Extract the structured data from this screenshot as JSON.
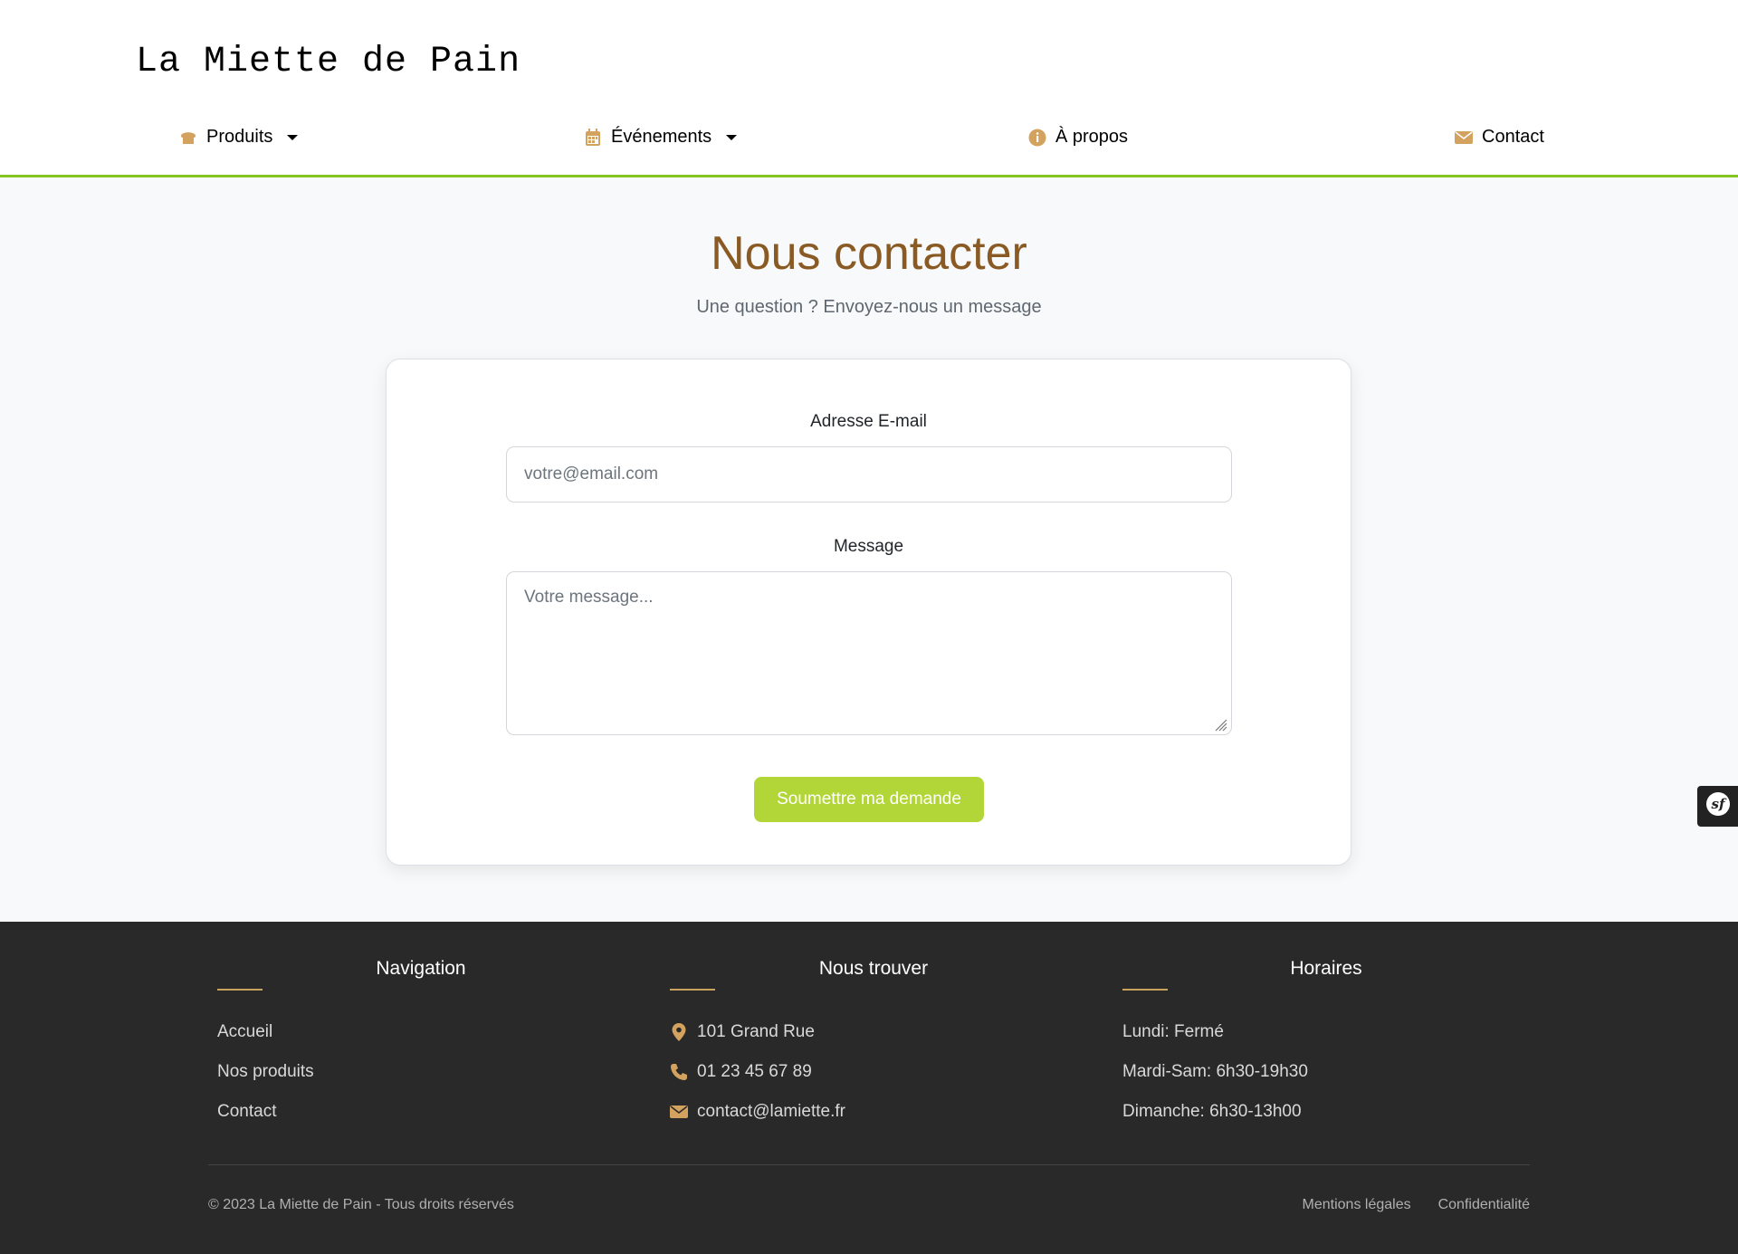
{
  "brand": "La Miette de Pain",
  "nav": {
    "products": "Produits",
    "events": "Événements",
    "about": "À propos",
    "contact": "Contact"
  },
  "page": {
    "title": "Nous contacter",
    "subtitle": "Une question ? Envoyez-nous un message"
  },
  "form": {
    "email_label": "Adresse E-mail",
    "email_placeholder": "votre@email.com",
    "message_label": "Message",
    "message_placeholder": "Votre message...",
    "submit": "Soumettre ma demande"
  },
  "footer": {
    "navigation": {
      "title": "Navigation",
      "items": [
        "Accueil",
        "Nos produits",
        "Contact"
      ]
    },
    "find_us": {
      "title": "Nous trouver",
      "address": "101 Grand Rue",
      "phone": "01 23 45 67 89",
      "email": "contact@lamiette.fr"
    },
    "hours": {
      "title": "Horaires",
      "items": [
        "Lundi: Fermé",
        "Mardi-Sam: 6h30-19h30",
        "Dimanche: 6h30-13h00"
      ]
    },
    "copyright": "© 2023 La Miette de Pain - Tous droits réservés",
    "legal": "Mentions légales",
    "privacy": "Confidentialité"
  },
  "colors": {
    "accent_green": "#84c51f",
    "button_green": "#b2d637",
    "title_brown": "#8a5a24",
    "icon_gold": "#d4a25f",
    "footer_bg": "#292929"
  },
  "icons": [
    "bread-icon",
    "calendar-icon",
    "info-icon",
    "envelope-icon",
    "map-pin-icon",
    "phone-icon",
    "symfony-icon"
  ]
}
